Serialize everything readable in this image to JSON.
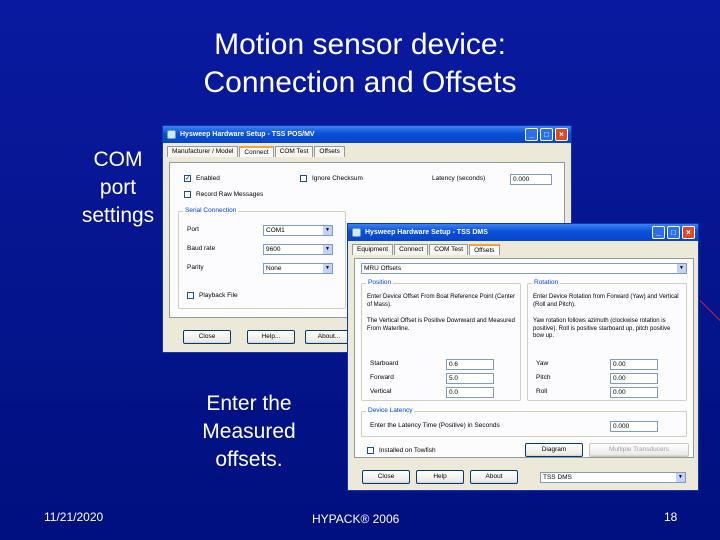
{
  "slide": {
    "title_line1": "Motion sensor device:",
    "title_line2": "Connection and Offsets",
    "label_com_1": "COM",
    "label_com_2": "port",
    "label_com_3": "settings",
    "label_enter_1": "Enter the",
    "label_enter_2": "Measured",
    "label_enter_3": "offsets.",
    "footer_date": "11/21/2020",
    "footer_center": "HYPACK® 2006",
    "footer_page": "18",
    "bg_color": "#00107e"
  },
  "dialog1": {
    "title": "Hysweep Hardware Setup - TSS POS/MV",
    "tabs": [
      "Manufacturer / Model",
      "Connect",
      "COM Test",
      "Offsets"
    ],
    "active_tab": "Connect",
    "enabled_label": "Enabled",
    "enabled_checked": "✓",
    "ignore_checksum_label": "Ignore Checksum",
    "latency_label": "Latency (seconds)",
    "latency_value": "0.000",
    "record_raw_label": "Record Raw Messages",
    "serial_group": "Serial Connection",
    "port_label": "Port",
    "port_value": "COM1",
    "baud_label": "Baud rate",
    "baud_value": "9600",
    "parity_label": "Parity",
    "parity_value": "None",
    "playback_label": "Playback File",
    "close_button": "Close",
    "help_button": "Help...",
    "about_button": "About..."
  },
  "dialog2": {
    "title": "Hysweep Hardware Setup - TSS DMS",
    "tabs": [
      "Equipment",
      "Connect",
      "COM Test",
      "Offsets"
    ],
    "active_tab": "Offsets",
    "offset_select": "MRU Offsets",
    "position_group": "Position",
    "position_text1": "Enter Device Offset From Boat Reference Point (Center of Mass).",
    "position_text2": "The Vertical Offset is Positive Downward and Measured From Waterline.",
    "starboard_label": "Starboard",
    "starboard_value": "0.6",
    "forward_label": "Forward",
    "forward_value": "5.0",
    "vertical_label": "Vertical",
    "vertical_value": "0.0",
    "rotation_group": "Rotation",
    "rotation_text1": "Enter Device Rotation from Forward (Yaw) and Vertical (Roll and Pitch).",
    "rotation_text2": "Yaw rotation follows azimuth (clockwise rotation is positive). Roll is positive starboard up, pitch positive bow up.",
    "yaw_label": "Yaw",
    "yaw_value": "0.00",
    "pitch_label": "Pitch",
    "pitch_value": "0.00",
    "roll_label": "Roll",
    "roll_value": "0.00",
    "latency_group": "Device Latency",
    "latency_label": "Enter the Latency Time (Positive) in Seconds",
    "latency_value": "0.000",
    "installed_label": "Installed on Towfish",
    "diagram_button": "Diagram",
    "multiple_button": "Multiple Transducers",
    "close_button": "Close",
    "help_button": "Help",
    "about_button": "About",
    "device_select": "TSS DMS"
  }
}
